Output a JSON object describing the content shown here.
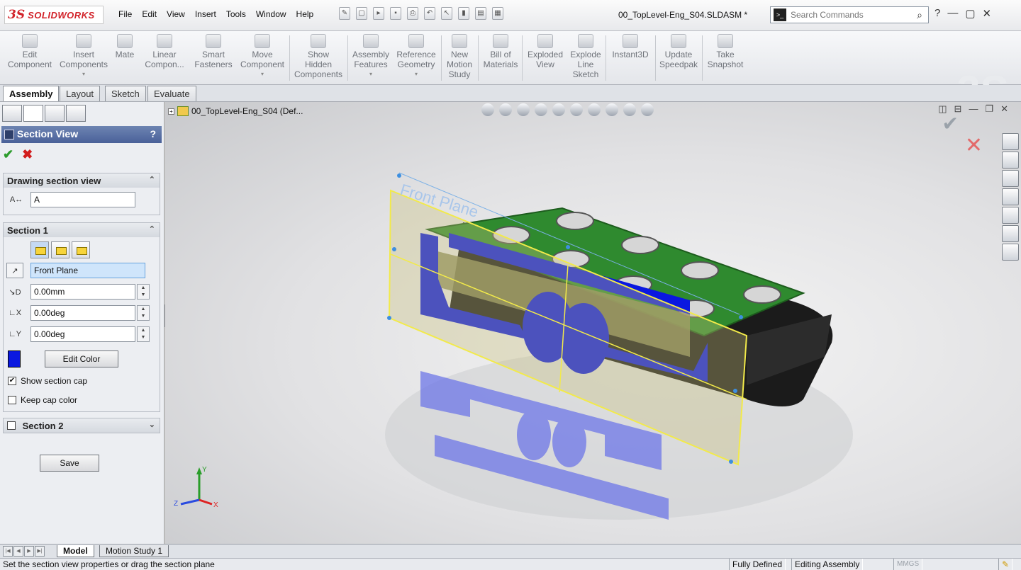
{
  "app": {
    "brand_mark": "3S",
    "brand_name": "SOLIDWORKS",
    "document_title": "00_TopLevel-Eng_S04.SLDASM *"
  },
  "menu": [
    "File",
    "Edit",
    "View",
    "Insert",
    "Tools",
    "Window",
    "Help"
  ],
  "search": {
    "placeholder": "Search Commands"
  },
  "commands": [
    {
      "label": "Edit\nComponent"
    },
    {
      "label": "Insert\nComponents"
    },
    {
      "label": "Mate"
    },
    {
      "label": "Linear\nCompon..."
    },
    {
      "label": "Smart\nFasteners"
    },
    {
      "label": "Move\nComponent"
    },
    {
      "label": "Show\nHidden\nComponents"
    },
    {
      "label": "Assembly\nFeatures"
    },
    {
      "label": "Reference\nGeometry"
    },
    {
      "label": "New\nMotion\nStudy"
    },
    {
      "label": "Bill of\nMaterials"
    },
    {
      "label": "Exploded\nView"
    },
    {
      "label": "Explode\nLine\nSketch"
    },
    {
      "label": "Instant3D"
    },
    {
      "label": "Update\nSpeedpak"
    },
    {
      "label": "Take\nSnapshot"
    }
  ],
  "tabs": [
    "Assembly",
    "Layout",
    "Sketch",
    "Evaluate"
  ],
  "property_manager": {
    "title": "Section View",
    "help": "?",
    "drawing_section": {
      "header": "Drawing section view",
      "value": "A"
    },
    "section1": {
      "header": "Section 1",
      "plane": "Front Plane",
      "offset": "0.00mm",
      "angle_x": "0.00deg",
      "angle_y": "0.00deg",
      "edit_color_label": "Edit Color",
      "cap_color": "#0a18e0",
      "show_section_cap": "Show section cap",
      "show_section_cap_checked": true,
      "keep_cap_color": "Keep cap color",
      "keep_cap_color_checked": false
    },
    "section2": {
      "header": "Section 2"
    },
    "save_label": "Save"
  },
  "tree": {
    "root": "00_TopLevel-Eng_S04  (Def..."
  },
  "viewport": {
    "plane_label": "Front Plane"
  },
  "bottom_tabs": [
    "Model",
    "Motion Study 1"
  ],
  "status": {
    "message": "Set the section view properties or drag the section plane",
    "defined": "Fully Defined",
    "mode": "Editing Assembly",
    "units": "MMGS"
  }
}
